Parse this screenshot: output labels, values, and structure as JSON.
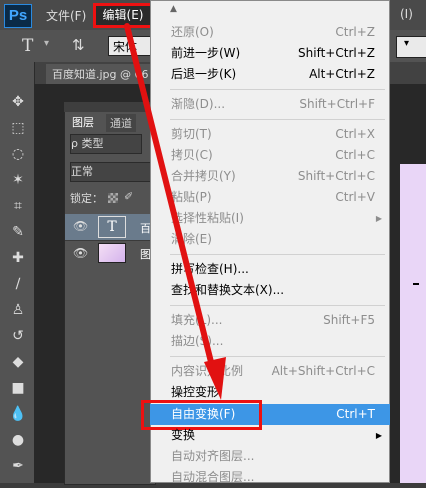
{
  "app": {
    "logo": "Ps"
  },
  "menubar": {
    "file": "文件(F)",
    "edit": "编辑(E)",
    "right_fragment": "(I)"
  },
  "options_bar": {
    "text_tool_glyph": "T",
    "font": "宋体"
  },
  "document": {
    "tab_label": "百度知道.jpg @ 66"
  },
  "layers_panel": {
    "tab_layers": "图层",
    "tab_channels": "通道",
    "filter": "ρ 类型",
    "blend_mode": "正常",
    "lock_label": "锁定：",
    "layers": [
      {
        "name": "百",
        "thumb": "T"
      },
      {
        "name": "图"
      }
    ]
  },
  "edit_menu": {
    "items": [
      {
        "label": "还原(O)",
        "shortcut": "Ctrl+Z"
      },
      {
        "label": "前进一步(W)",
        "shortcut": "Shift+Ctrl+Z"
      },
      {
        "label": "后退一步(K)",
        "shortcut": "Alt+Ctrl+Z"
      },
      {
        "label": "渐隐(D)...",
        "shortcut": "Shift+Ctrl+F"
      },
      {
        "label": "剪切(T)",
        "shortcut": "Ctrl+X"
      },
      {
        "label": "拷贝(C)",
        "shortcut": "Ctrl+C"
      },
      {
        "label": "合并拷贝(Y)",
        "shortcut": "Shift+Ctrl+C"
      },
      {
        "label": "粘贴(P)",
        "shortcut": "Ctrl+V"
      },
      {
        "label": "选择性粘贴(I)"
      },
      {
        "label": "清除(E)"
      },
      {
        "label": "拼写检查(H)..."
      },
      {
        "label": "查找和替换文本(X)..."
      },
      {
        "label": "填充(L)...",
        "shortcut": "Shift+F5"
      },
      {
        "label": "描边(S)..."
      },
      {
        "label": "内容识别比例",
        "shortcut": "Alt+Shift+Ctrl+C"
      },
      {
        "label": "操控变形"
      },
      {
        "label": "自由变换(F)",
        "shortcut": "Ctrl+T"
      },
      {
        "label": "变换"
      },
      {
        "label": "自动对齐图层..."
      },
      {
        "label": "自动混合图层..."
      }
    ]
  },
  "colors": {
    "highlight": "#3d96e6",
    "annotation_red": "#e11111",
    "menu_bg": "#f0f0f0"
  }
}
